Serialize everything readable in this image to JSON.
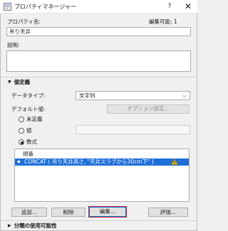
{
  "window": {
    "title": "プロパティマネージャー",
    "help": "?",
    "close": "✕"
  },
  "property_name": {
    "label": "プロパティ名:",
    "edit_count": "編集可能: 1",
    "value": "吊り天井"
  },
  "description": {
    "label": "説明:"
  },
  "definition": {
    "header": "値定義",
    "data_type_label": "データタイプ:",
    "data_type_value": "文字列",
    "default_label": "デフォルト値:",
    "option_settings": "オプション設定...",
    "options": {
      "undefined": "未定義",
      "value": "値",
      "formula": "数式"
    },
    "selected_option": "formula"
  },
  "table": {
    "header": "順番",
    "rows": [
      {
        "text": "CONCAT ( 吊り天井高さ, \"天井スラブから30cm下\" )",
        "warning": true
      }
    ]
  },
  "buttons": {
    "add": "追加...",
    "delete": "削除",
    "edit": "編集...",
    "evaluate": "評価..."
  },
  "classification": {
    "header": "分類の使用可能性"
  },
  "colors": {
    "selection": "#1e6fd9",
    "warning": "#f2c200",
    "focus_ring": "#d01c24"
  }
}
